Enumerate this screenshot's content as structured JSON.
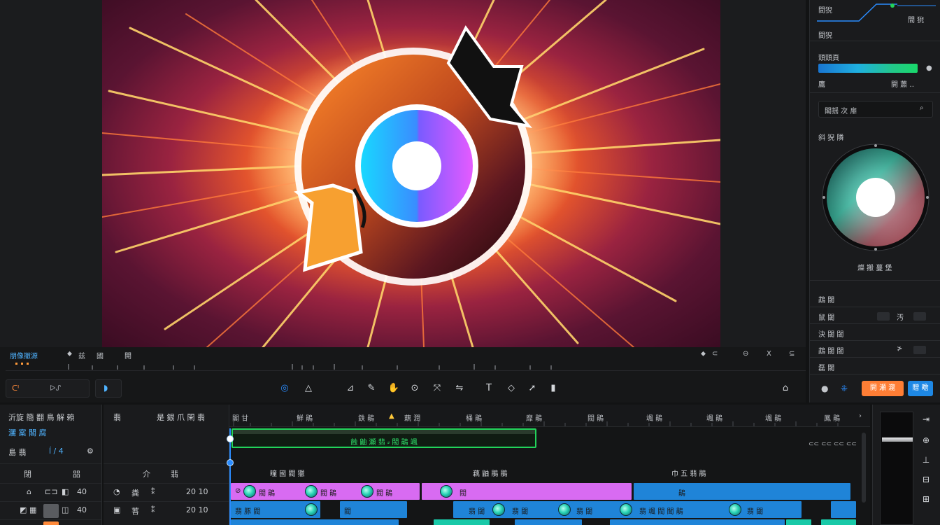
{
  "colors": {
    "accent_blue": "#2a8cff",
    "accent_orange": "#ff7e35",
    "clip_magenta": "#d86bf2",
    "clip_blue": "#1f84d8",
    "clip_teal": "#19c9a8",
    "marker_green": "#22d35a"
  },
  "viewer": {
    "label_left": "朋像撤源",
    "label_a": "⬥",
    "label_b": "兹",
    "label_c": "國",
    "label_d": "開",
    "right_labels": [
      "⬥",
      "⊂",
      "⊖",
      "Ⅹ",
      "⊆"
    ],
    "timecode": "ᑕᑊ",
    "timecode_unit": "ᐅᔑ",
    "tools": [
      "record-icon",
      "mask-icon",
      "crop-icon",
      "pen-icon",
      "hand-icon",
      "zoom-icon",
      "transform-icon",
      "mirror-icon",
      "text-icon",
      "shape-icon",
      "trash-icon"
    ],
    "export_icon": "export-icon"
  },
  "inspector": {
    "row1": "間猊",
    "row1b": "間 猊",
    "gradient_label": "頭頭頁",
    "gradient_left": "鷹",
    "gradient_right": "開 蕭 ‥",
    "search_placeholder": "閣揺 次 扉",
    "color_label": "斜 猊 隣",
    "wheel_caption": "燦 搬 蔓 堡",
    "props": [
      {
        "label": "鵡 閾",
        "value": ""
      },
      {
        "label": "鼠 閾",
        "value": "汚"
      },
      {
        "label": "決 閾 閾",
        "value": ""
      },
      {
        "label": "鵡 閾 閾",
        "value": "≯"
      },
      {
        "label": "磊 閾",
        "value": ""
      }
    ],
    "btn_orange": "開 瀬 瀧",
    "btn_blue": "贈 瞻"
  },
  "media_panel": {
    "title": "沂旋 簡 翻 鳥 解 賴",
    "subtitle": "灑 案 閣 腐",
    "row_a": "島 翡",
    "row_a_val": "ĺ / 4",
    "col_a": "閉",
    "col_b": "㗊",
    "row2_val": "40",
    "row3_val": "40"
  },
  "track_heads": {
    "title": "翡",
    "subtitle": "是 銀 爪 閑 翡",
    "col_a": "介",
    "col_b": "翡",
    "row1_name": "粪",
    "row1_val": "20 10",
    "row2_name": "䓊",
    "row2_val": "20 10"
  },
  "timeline": {
    "ruler": [
      "閣 甘",
      "鮮 鵑",
      "鉄 鵑",
      "藕 潤",
      "桶 鵑",
      "靡 鵑",
      "閥 鵑",
      "颯 鵑",
      "颯 鵑",
      "颯 鵑",
      "鳳 鵑",
      "鳳 鵑"
    ],
    "marker_clip": "蝕 鼬 瀬 翡 ⸗ 閥 鵑 颯",
    "sections": [
      "瞳 國 閥 獵",
      "藕 鼬 鵑 鵑",
      "巾 五 翡 鵑"
    ],
    "track1": [
      "閥 鵑",
      "閥",
      "鵑"
    ],
    "track2": [
      "翡 豚 閥",
      "閥",
      "翡 閾",
      "翡 颯 閥 聞 鵑"
    ],
    "right_ticks": "⊂⊂ ⊂⊂ ⊂⊂ ⊂⊂"
  },
  "meter": {
    "tools": [
      "⇥",
      "⊕",
      "⊥",
      "⊟",
      "⊞"
    ]
  }
}
